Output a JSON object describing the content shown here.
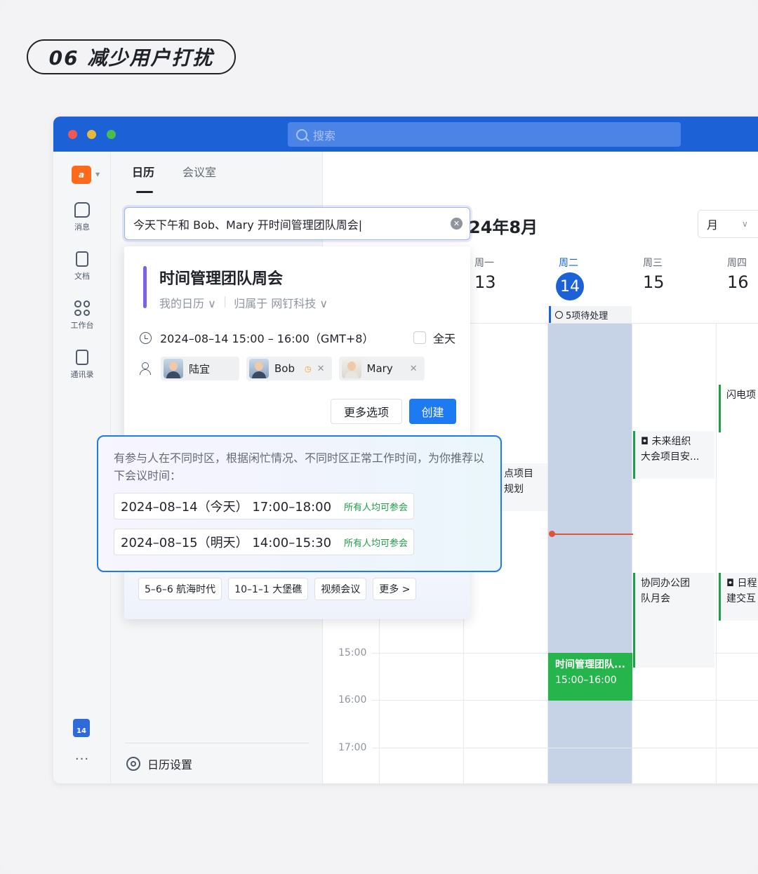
{
  "caption": "06 减少用户打扰",
  "search": {
    "placeholder": "搜索"
  },
  "sidebar": {
    "logo": "a",
    "items": [
      {
        "label": "消息",
        "icon": "chat-icon"
      },
      {
        "label": "文档",
        "icon": "doc-icon"
      },
      {
        "label": "工作台",
        "icon": "grid-icon"
      },
      {
        "label": "通讯录",
        "icon": "contacts-icon"
      }
    ],
    "calendar_badge": "14",
    "more": "···"
  },
  "leftpanel": {
    "tabs": [
      "日历",
      "会议室"
    ],
    "settings": "日历设置"
  },
  "calendar": {
    "month": "24年8月",
    "view": "月",
    "days": [
      {
        "weekday": "周一",
        "date": "13"
      },
      {
        "weekday": "周二",
        "date": "14"
      },
      {
        "weekday": "周三",
        "date": "15"
      },
      {
        "weekday": "周四",
        "date": "16"
      }
    ],
    "pending": "5项待处理",
    "hours": [
      "15:00",
      "16:00",
      "17:00"
    ],
    "events": {
      "flash": "闪电项",
      "future_line1": "未来组织",
      "future_line2": "大会项目安...",
      "mon_line1": "点项目",
      "mon_line2": "规划",
      "collab_line1": "协同办公团",
      "collab_line2": "队月会",
      "thu_line1": "日程",
      "thu_line2": "建交互",
      "new_title": "时间管理团队...",
      "new_time": "15:00–16:00"
    }
  },
  "input": {
    "value": "今天下午和 Bob、Mary 开时间管理团队周会|"
  },
  "card": {
    "title": "时间管理团队周会",
    "calendar": "我的日历 ∨",
    "belongs": "归属于 网钉科技 ∨",
    "time": "2024–08–14 15:00 – 16:00（GMT+8）",
    "allday": "全天",
    "attendees": [
      "陆宜",
      "Bob",
      "Mary"
    ],
    "more_button": "更多选项",
    "create_button": "创建",
    "rooms": [
      "5–6–6 航海时代",
      "10–1–1 大堡礁",
      "视频会议",
      "更多 >"
    ]
  },
  "suggest": {
    "message": "有参与人在不同时区，根据闲忙情况、不同时区正常工作时间，为你推荐以下会议时间：",
    "slots": [
      {
        "time": "2024–08–14（今天） 17:00–18:00",
        "status": "所有人均可参会"
      },
      {
        "time": "2024–08–15（明天） 14:00–15:30",
        "status": "所有人均可参会"
      }
    ]
  }
}
